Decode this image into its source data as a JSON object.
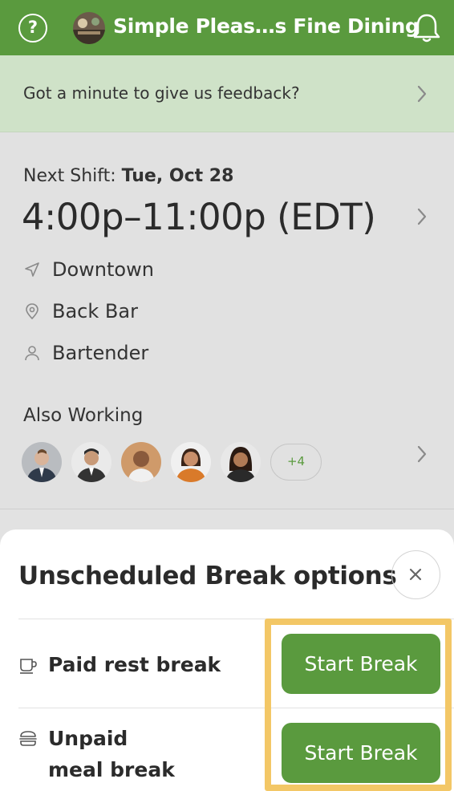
{
  "header": {
    "help_icon": "help-circle-icon",
    "business_name": "Simple Pleas…s Fine Dining",
    "notifications_icon": "bell-icon"
  },
  "feedback_banner": {
    "text": "Got a minute to give us feedback?"
  },
  "next_shift": {
    "label": "Next Shift:",
    "date": "Tue, Oct 28",
    "time": "4:00p–11:00p (EDT)",
    "location": "Downtown",
    "station": "Back Bar",
    "role": "Bartender"
  },
  "also_working": {
    "label": "Also Working",
    "more_count": "+4"
  },
  "break_sheet": {
    "title": "Unscheduled Break options",
    "close_symbol": "×",
    "options": [
      {
        "label_line1": "Paid rest break",
        "label_line2": "",
        "button": "Start Break"
      },
      {
        "label_line1": "Unpaid",
        "label_line2": "meal break",
        "button": "Start Break"
      }
    ]
  },
  "colors": {
    "brand_green": "#5a9a3e",
    "banner_green": "#cfe2c8",
    "highlight_yellow": "#f3c766"
  }
}
